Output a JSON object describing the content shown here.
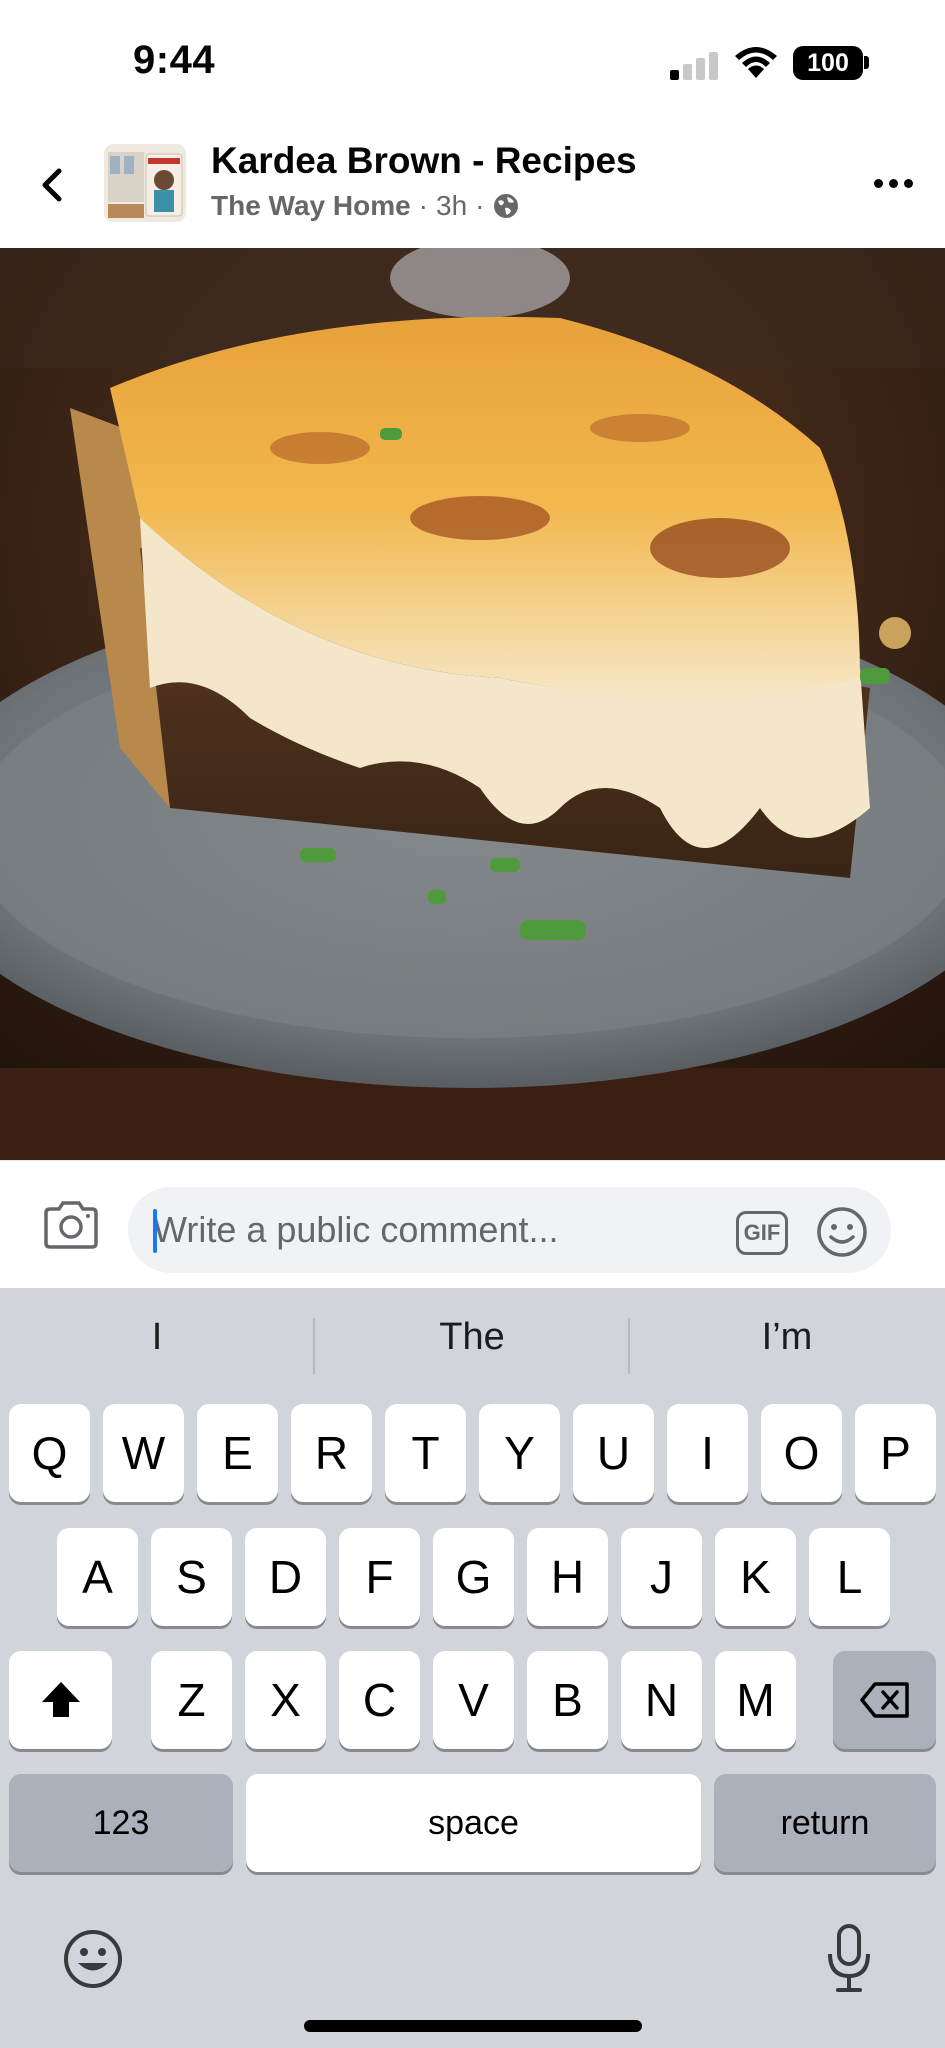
{
  "status_bar": {
    "time": "9:44",
    "battery": "100",
    "signal_bars": 1,
    "icons": [
      "cellular-signal-icon",
      "wifi-icon",
      "battery-icon"
    ]
  },
  "header": {
    "page_name": "Kardea Brown - Recipes",
    "group_name": "The Way Home",
    "separator": "·",
    "time_ago": "3h",
    "icons": [
      "back-chevron-icon",
      "globe-icon",
      "more-dots-icon"
    ]
  },
  "photo": {
    "subject": "food-photo"
  },
  "comment_bar": {
    "placeholder": "Write a public comment...",
    "gif_label": "GIF",
    "icons": [
      "camera-icon",
      "smiley-icon"
    ]
  },
  "keyboard": {
    "suggestions": [
      "I",
      "The",
      "I’m"
    ],
    "row1": [
      "Q",
      "W",
      "E",
      "R",
      "T",
      "Y",
      "U",
      "I",
      "O",
      "P"
    ],
    "row2": [
      "A",
      "S",
      "D",
      "F",
      "G",
      "H",
      "J",
      "K",
      "L"
    ],
    "row3": [
      "Z",
      "X",
      "C",
      "V",
      "B",
      "N",
      "M"
    ],
    "numbers_label": "123",
    "space_label": "space",
    "return_label": "return",
    "icons": [
      "shift-icon",
      "delete-icon",
      "emoji-keyboard-icon",
      "microphone-icon"
    ]
  },
  "colors": {
    "accent": "#1877f2",
    "keyboard_bg": "#d1d4db",
    "secondary_text": "#65676b"
  }
}
